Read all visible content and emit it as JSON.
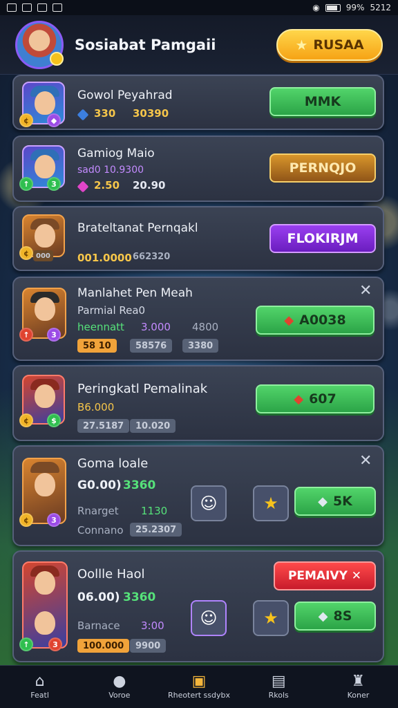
{
  "status_bar": {
    "time": "5212",
    "battery": "99%"
  },
  "header": {
    "player_name": "Sosiabat Pamgaii",
    "action_button": "RUSAA"
  },
  "cards": [
    {
      "title": "Gowol Peyahrad",
      "stats": [
        "330",
        "30390"
      ],
      "action": "MMK",
      "action_style": "green"
    },
    {
      "title": "Gamiog Maio",
      "subtitle": "sad0 10.9300",
      "stats": [
        "2.50",
        "20.90"
      ],
      "action": "PERNQJO",
      "action_style": "gold"
    },
    {
      "title": "Brateltanat Pernqakl",
      "stats": [
        "001.0000",
        "662320"
      ],
      "badge": "000",
      "action": "FLOKIRJM",
      "action_style": "purple"
    },
    {
      "title": "Manlahet Pen Meah",
      "subtitle": "Parmial Rea0",
      "row1": [
        "heennatt",
        "3.000",
        "4800"
      ],
      "chips": [
        "58 10",
        "58576",
        "3380"
      ],
      "action": "A0038",
      "action_style": "green",
      "close": "✕"
    },
    {
      "title": "Peringkatl Pemalinak",
      "subtitle": "B6.000",
      "chips": [
        "27.5187",
        "10.020"
      ],
      "action": "607",
      "action_style": "green"
    },
    {
      "title": "Goma loale",
      "value_main": "G0.00)",
      "value_green": "3360",
      "row1": [
        "Rnarget",
        "1130"
      ],
      "row2": [
        "Connano",
        "25.2307"
      ],
      "action": "5K",
      "action_style": "green",
      "close": "✕"
    },
    {
      "title": "Oollle Haol",
      "value_main": "06.00)",
      "value_green": "3360",
      "row1": [
        "Barnace",
        "3:00"
      ],
      "chips": [
        "100.000",
        "9900"
      ],
      "top_action": "PEMAIVY ✕",
      "action": "8S",
      "action_style": "green"
    }
  ],
  "bottom_nav": [
    {
      "label": "Featl",
      "icon": "home-icon"
    },
    {
      "label": "Voroe",
      "icon": "chat-icon"
    },
    {
      "label": "Rheotert ssdybx",
      "icon": "chest-icon"
    },
    {
      "label": "Rkols",
      "icon": "cards-icon"
    },
    {
      "label": "Koner",
      "icon": "trophy-icon"
    }
  ],
  "colors": {
    "accent_gold": "#f6a315",
    "green": "#2ba447",
    "purple": "#6a1dbf",
    "red": "#c81b2b"
  }
}
